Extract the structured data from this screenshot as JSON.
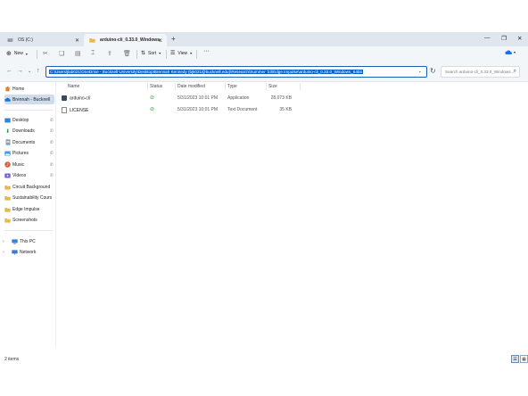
{
  "tabs": [
    {
      "title": "OS (C:)",
      "icon": "drive-icon"
    },
    {
      "title": "arduino-cli_0.33.0_Windows_64bit",
      "icon": "folder-icon"
    }
  ],
  "toolbar": {
    "new_label": "New",
    "sort_label": "Sort",
    "view_label": "View",
    "more_label": "···"
  },
  "address": {
    "path": "C:\\Users\\jlab021\\OneDrive - Bucknell University\\Desktop\\Brennah Kennedy (bjk021@bucknell.edu)\\Research\\Summer '23\\Edge Impulse\\arduino-cli_0.33.0_Windows_64bit"
  },
  "search": {
    "placeholder": "Search arduino-cli_0.33.0_Windows..."
  },
  "sidebar": {
    "top": [
      {
        "label": "Home",
        "icon": "home-icon"
      },
      {
        "label": "Brennah - Bucknell",
        "icon": "cloud-icon"
      }
    ],
    "quick_access": [
      {
        "label": "Desktop",
        "icon": "desktop-icon",
        "pinned": true
      },
      {
        "label": "Downloads",
        "icon": "download-icon",
        "pinned": true
      },
      {
        "label": "Documents",
        "icon": "document-icon",
        "pinned": true
      },
      {
        "label": "Pictures",
        "icon": "pictures-icon",
        "pinned": true
      },
      {
        "label": "Music",
        "icon": "music-icon",
        "pinned": true
      },
      {
        "label": "Videos",
        "icon": "video-icon",
        "pinned": true
      },
      {
        "label": "Circuit Background",
        "icon": "folder-icon",
        "pinned": false
      },
      {
        "label": "Sustainability Cours",
        "icon": "folder-icon",
        "pinned": false
      },
      {
        "label": "Edge Impulse",
        "icon": "folder-icon",
        "pinned": false
      },
      {
        "label": "Screenshots",
        "icon": "folder-icon",
        "pinned": false
      }
    ],
    "bottom": [
      {
        "label": "This PC",
        "icon": "pc-icon"
      },
      {
        "label": "Network",
        "icon": "network-icon"
      }
    ]
  },
  "columns": {
    "name": "Name",
    "status": "Status",
    "date": "Date modified",
    "type": "Type",
    "size": "Size"
  },
  "files": [
    {
      "name": "arduino-cli",
      "date": "5/31/2023 10:01 PM",
      "type": "Application",
      "size": "28,073 KB"
    },
    {
      "name": "LICENSE",
      "date": "5/31/2023 10:01 PM",
      "type": "Text Document",
      "size": "35 KB"
    }
  ],
  "status": {
    "item_count": "2 items"
  },
  "colors": {
    "accent": "#0c63c6",
    "titlebar": "#dfe6ee",
    "toolbar": "#f3f6f9",
    "sync_ok": "#2e9a45",
    "folder": "#e8b84a"
  }
}
